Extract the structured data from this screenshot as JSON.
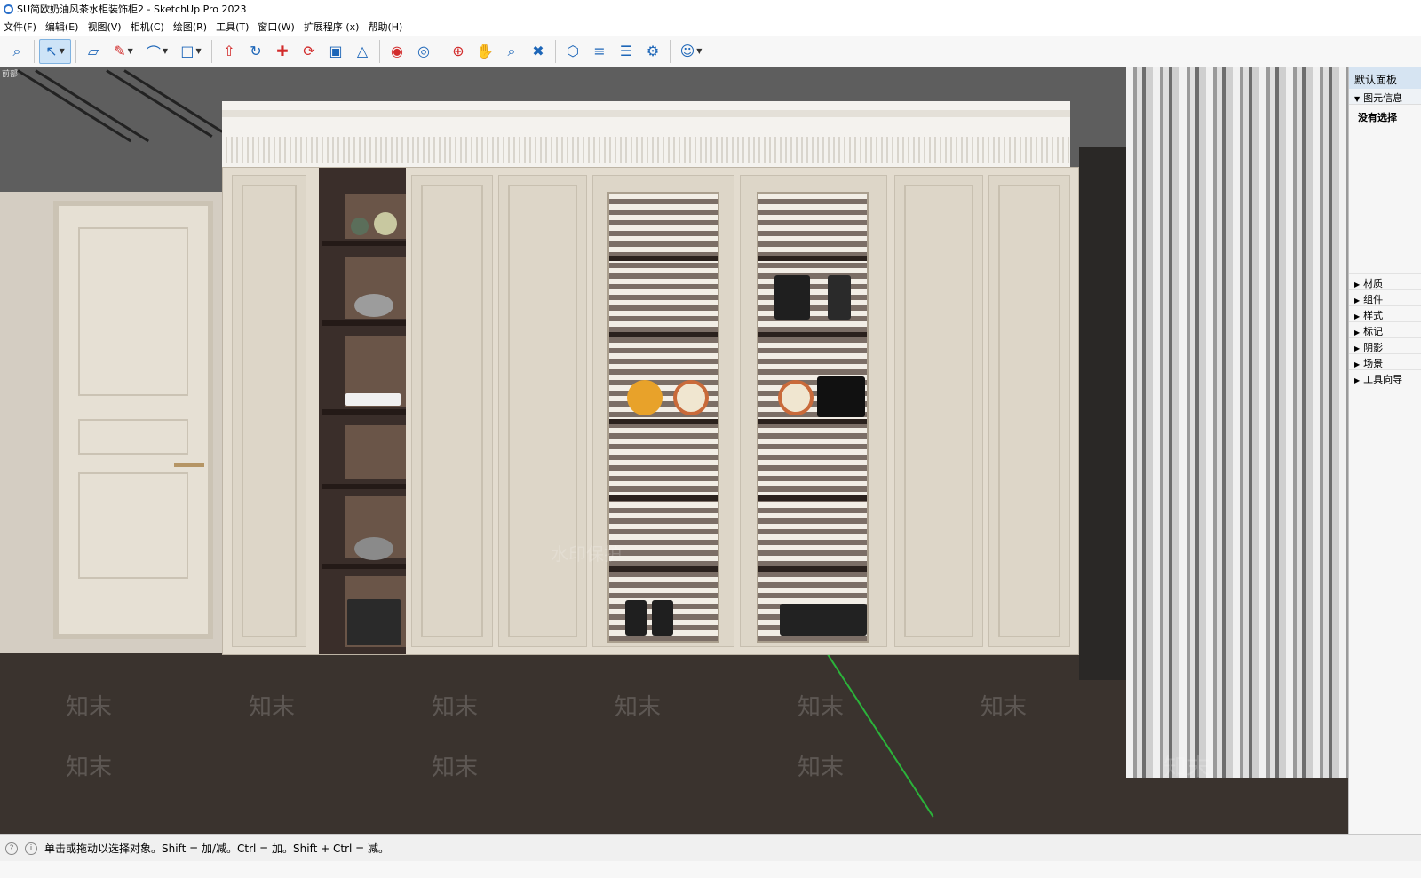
{
  "window": {
    "title": "SU简欧奶油风茶水柜装饰柜2 - SketchUp Pro 2023"
  },
  "menu": [
    "文件(F)",
    "编辑(E)",
    "视图(V)",
    "相机(C)",
    "绘图(R)",
    "工具(T)",
    "窗口(W)",
    "扩展程序 (x)",
    "帮助(H)"
  ],
  "toolbar": {
    "tools": [
      "search-icon",
      "select-icon",
      "eraser-icon",
      "pencil-icon",
      "arc-icon",
      "rectangle-icon",
      "push-pull-icon",
      "follow-me-icon",
      "move-icon",
      "rotate-icon",
      "scale-icon",
      "tape-measure-icon",
      "paint-bucket-icon",
      "orbit-icon",
      "section-plane-icon",
      "pan-icon",
      "zoom-icon",
      "zoom-extents-icon",
      "warehouse-icon",
      "extension-icon",
      "layers-icon",
      "styles-icon",
      "account-icon"
    ]
  },
  "viewport": {
    "axis_label": "前部",
    "watermark_text": "知末",
    "watermark_notice": "水印保护"
  },
  "tray": {
    "title": "默认面板",
    "entity_info": "图元信息",
    "no_selection": "没有选择",
    "sections": [
      "材质",
      "组件",
      "样式",
      "标记",
      "阴影",
      "场景",
      "工具向导"
    ]
  },
  "status": {
    "hint": "单击或拖动以选择对象。Shift = 加/减。Ctrl = 加。Shift + Ctrl = 减。"
  }
}
